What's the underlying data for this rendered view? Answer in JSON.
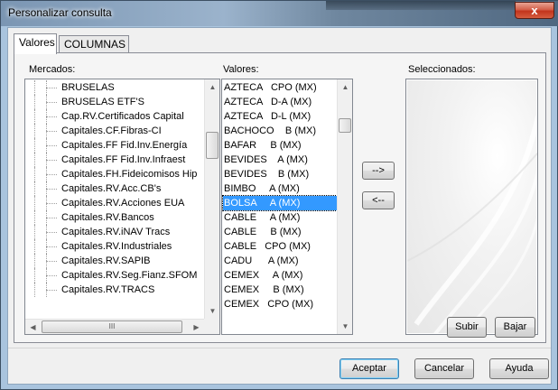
{
  "window": {
    "title": "Personalizar consulta",
    "close_glyph": "x"
  },
  "tabs": [
    {
      "label": "Valores",
      "active": true
    },
    {
      "label": "COLUMNAS",
      "active": false
    }
  ],
  "mercados": {
    "label": "Mercados:",
    "items": [
      "BRUSELAS",
      "BRUSELAS ETF'S",
      "Cap.RV.Certificados Capital",
      "Capitales.CF.Fibras-CI",
      "Capitales.FF Fid.Inv.Energía",
      "Capitales.FF Fid.Inv.Infraest",
      "Capitales.FH.Fideicomisos Hip",
      "Capitales.RV.Acc.CB's",
      "Capitales.RV.Acciones EUA",
      "Capitales.RV.Bancos",
      "Capitales.RV.iNAV Tracs",
      "Capitales.RV.Industriales",
      "Capitales.RV.SAPIB",
      "Capitales.RV.Seg.Fianz.SFOM",
      "Capitales.RV.TRACS"
    ],
    "hscroll_glyph": "III"
  },
  "valores": {
    "label": "Valores:",
    "items": [
      "AZTECA   CPO (MX)",
      "AZTECA   D-A (MX)",
      "AZTECA   D-L (MX)",
      "BACHOCO    B (MX)",
      "BAFAR     B (MX)",
      "BEVIDES    A (MX)",
      "BEVIDES    B (MX)",
      "BIMBO     A (MX)",
      "BOLSA     A (MX)",
      "CABLE     A (MX)",
      "CABLE     B (MX)",
      "CABLE   CPO (MX)",
      "CADU      A (MX)",
      "CEMEX     A (MX)",
      "CEMEX     B (MX)",
      "CEMEX   CPO (MX)"
    ],
    "selected_index": 8
  },
  "transfer": {
    "add_label": "-->",
    "remove_label": "<--"
  },
  "seleccionados": {
    "label": "Seleccionados:",
    "items": []
  },
  "order_buttons": {
    "up_label": "Subir",
    "down_label": "Bajar"
  },
  "footer": {
    "accept_label": "Aceptar",
    "cancel_label": "Cancelar",
    "help_label": "Ayuda"
  },
  "colors": {
    "selection": "#3399ff",
    "window_frame": "#a9c4de",
    "close_button": "#c2341c"
  },
  "icons": {
    "scroll_up": "triangle-up",
    "scroll_down": "triangle-down",
    "scroll_left": "triangle-left",
    "scroll_right": "triangle-right"
  }
}
